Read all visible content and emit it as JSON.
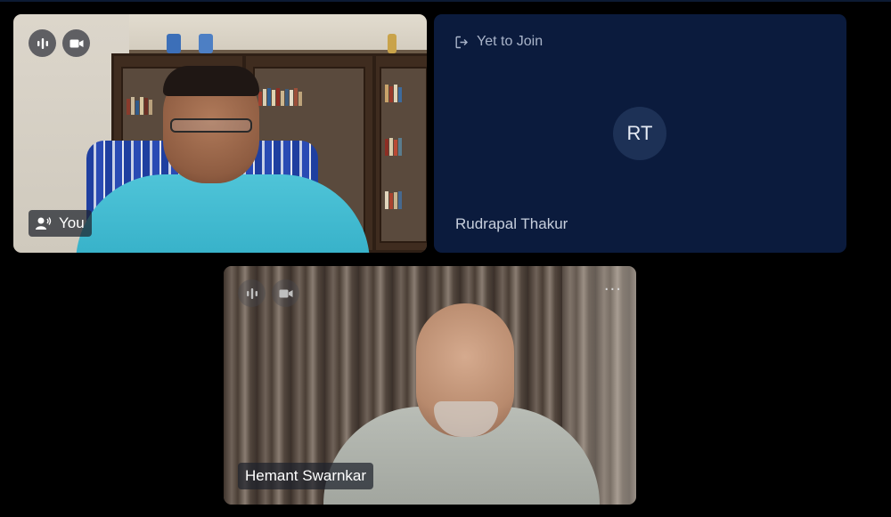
{
  "tiles": {
    "you": {
      "name_label": "You",
      "controls": [
        "audio-wave-icon",
        "video-camera-icon"
      ]
    },
    "rudrapal": {
      "status": "Yet to Join",
      "initials": "RT",
      "name": "Rudrapal Thakur"
    },
    "hemant": {
      "name": "Hemant Swarnkar",
      "controls": [
        "audio-wave-icon",
        "video-camera-icon"
      ],
      "more_label": "···"
    }
  },
  "colors": {
    "background": "#000000",
    "pending_tile": "#0b1b3d",
    "avatar_bg": "#1d3156"
  }
}
